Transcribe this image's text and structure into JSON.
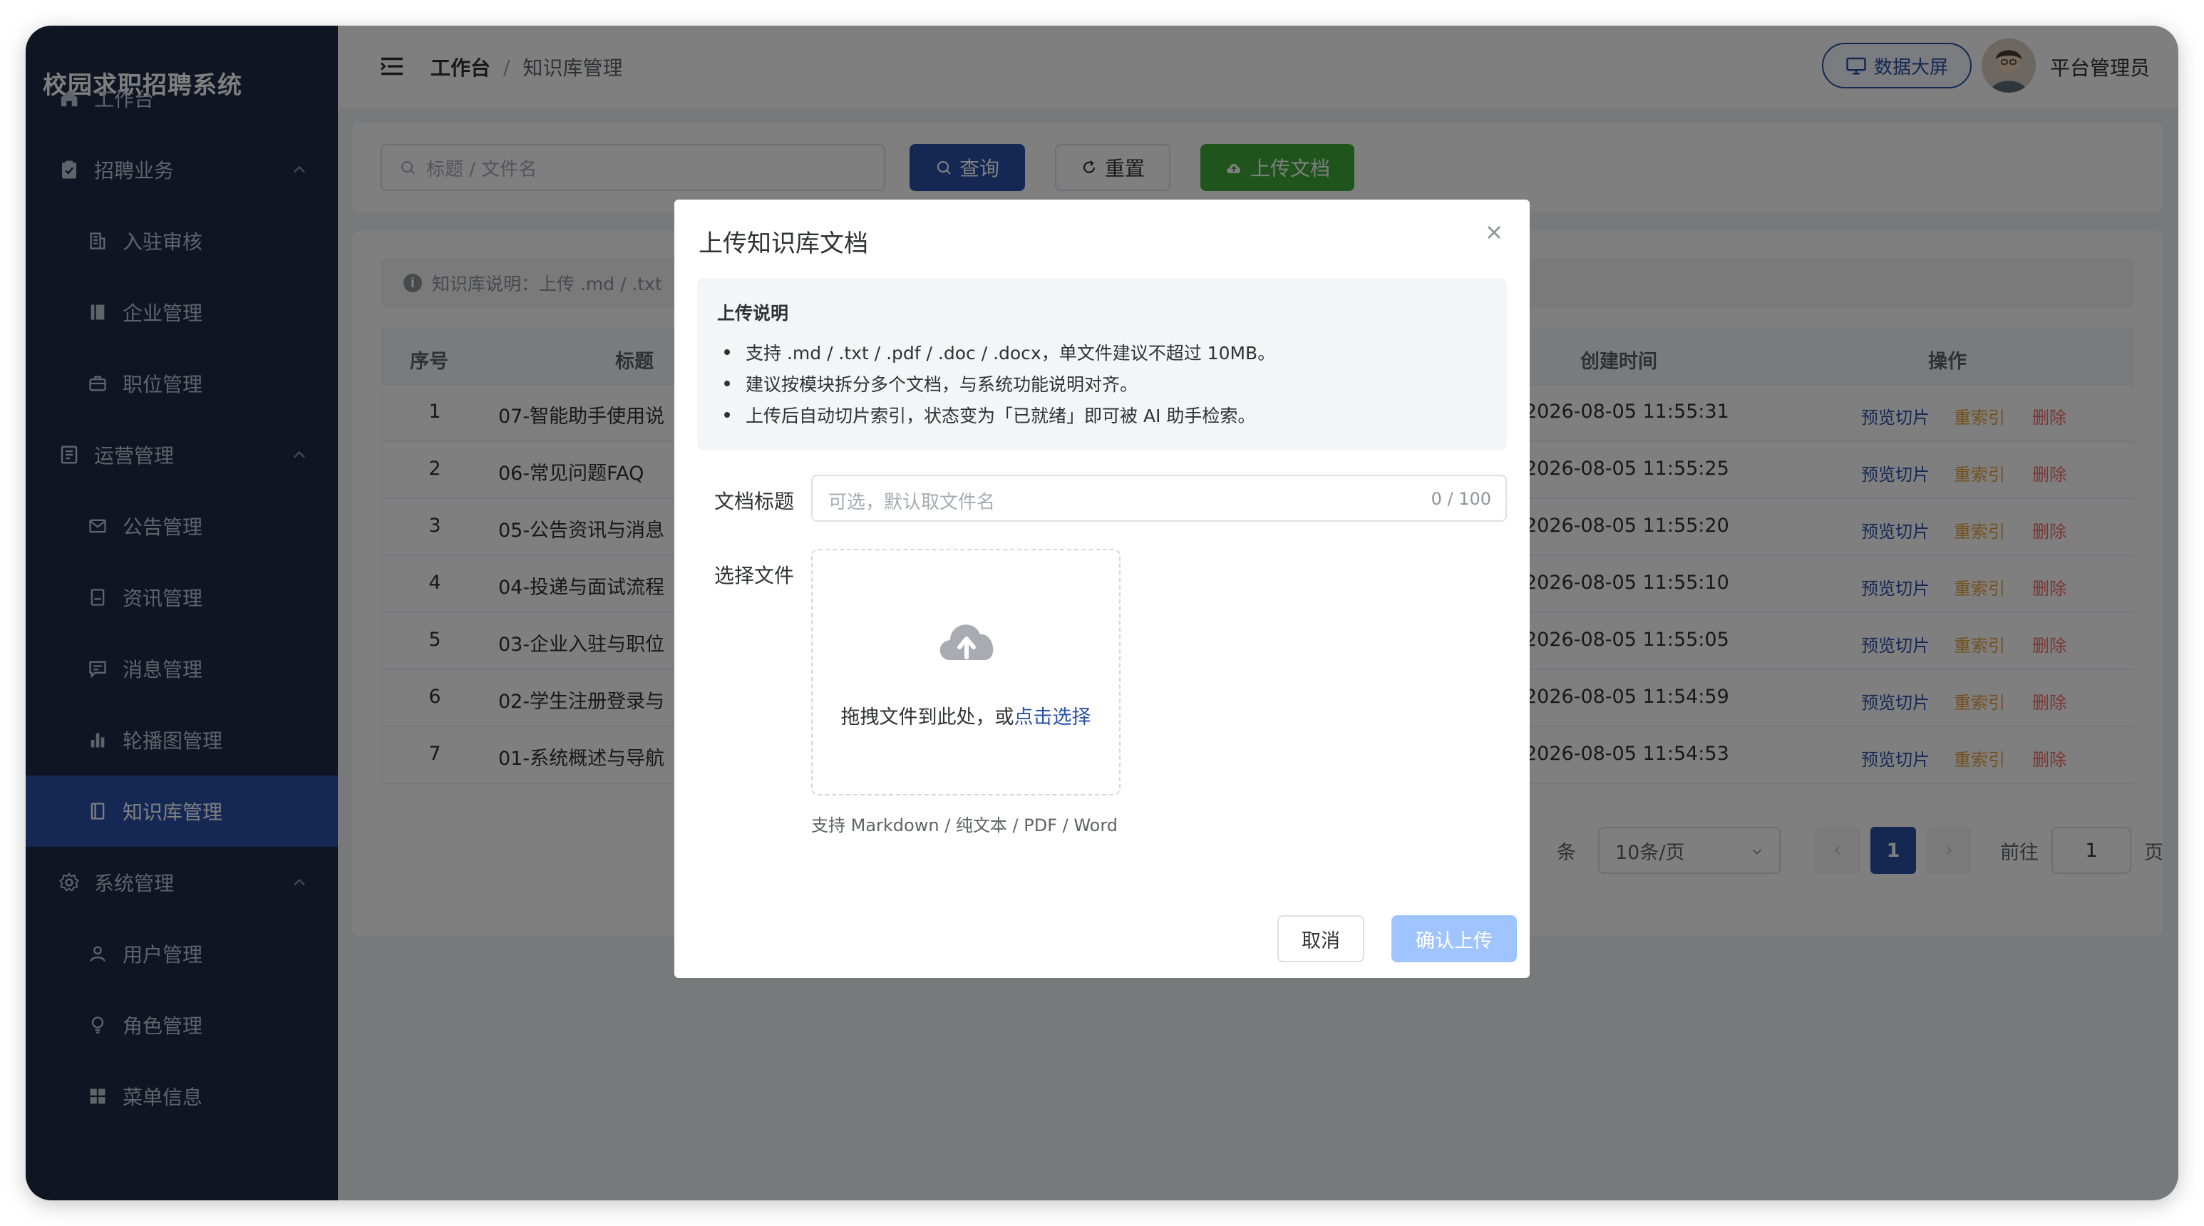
{
  "app": {
    "title": "校园求职招聘系统"
  },
  "sidebar": {
    "items": [
      {
        "label": "工作台",
        "icon": "home-icon"
      },
      {
        "label": "招聘业务",
        "icon": "clipboard-check-icon"
      },
      {
        "label": "入驻审核",
        "icon": "building-icon"
      },
      {
        "label": "企业管理",
        "icon": "book-icon"
      },
      {
        "label": "职位管理",
        "icon": "briefcase-icon"
      },
      {
        "label": "运营管理",
        "icon": "document-icon"
      },
      {
        "label": "公告管理",
        "icon": "mail-icon"
      },
      {
        "label": "资讯管理",
        "icon": "news-icon"
      },
      {
        "label": "消息管理",
        "icon": "message-icon"
      },
      {
        "label": "轮播图管理",
        "icon": "bar-chart-icon"
      },
      {
        "label": "知识库管理",
        "icon": "notebook-icon"
      },
      {
        "label": "系统管理",
        "icon": "gear-icon"
      },
      {
        "label": "用户管理",
        "icon": "user-icon"
      },
      {
        "label": "角色管理",
        "icon": "bulb-icon"
      },
      {
        "label": "菜单信息",
        "icon": "grid-icon"
      }
    ],
    "active": "知识库管理"
  },
  "header": {
    "breadcrumb": [
      "工作台",
      "知识库管理"
    ],
    "breadcrumb_sep": "/",
    "screen_button": "数据大屏",
    "user_name": "平台管理员"
  },
  "search": {
    "placeholder": "标题 / 文件名",
    "query_label": "查询",
    "reset_label": "重置",
    "upload_label": "上传文档"
  },
  "notice": {
    "text": "知识库说明：上传 .md / .txt"
  },
  "table": {
    "columns": [
      "序号",
      "标题",
      "创建时间",
      "操作"
    ],
    "rows": [
      {
        "index": "1",
        "title": "07-智能助手使用说",
        "created": "2026-08-05 11:55:31"
      },
      {
        "index": "2",
        "title": "06-常见问题FAQ",
        "created": "2026-08-05 11:55:25"
      },
      {
        "index": "3",
        "title": "05-公告资讯与消息",
        "created": "2026-08-05 11:55:20"
      },
      {
        "index": "4",
        "title": "04-投递与面试流程",
        "created": "2026-08-05 11:55:10"
      },
      {
        "index": "5",
        "title": "03-企业入驻与职位",
        "created": "2026-08-05 11:55:05"
      },
      {
        "index": "6",
        "title": "02-学生注册登录与",
        "created": "2026-08-05 11:54:59"
      },
      {
        "index": "7",
        "title": "01-系统概述与导航",
        "created": "2026-08-05 11:54:53"
      }
    ],
    "actions": {
      "preview": "预览切片",
      "reindex": "重索引",
      "delete": "删除"
    }
  },
  "pagination": {
    "total_suffix": "条",
    "page_size": "10条/页",
    "current_page": "1",
    "goto_prefix": "前往",
    "goto_value": "1",
    "goto_suffix": "页"
  },
  "dialog": {
    "title": "上传知识库文档",
    "info_title": "上传说明",
    "info_items": [
      "支持 .md / .txt / .pdf / .doc / .docx，单文件建议不超过 10MB。",
      "建议按模块拆分多个文档，与系统功能说明对齐。",
      "上传后自动切片索引，状态变为「已就绪」即可被 AI 助手检索。"
    ],
    "title_label": "文档标题",
    "title_placeholder": "可选，默认取文件名",
    "title_counter": "0 / 100",
    "file_label": "选择文件",
    "drop_text": "拖拽文件到此处，或",
    "drop_link": "点击选择",
    "drop_tip": "支持 Markdown / 纯文本 / PDF / Word",
    "cancel_label": "取消",
    "confirm_label": "确认上传"
  },
  "colors": {
    "sidebar_bg": "#1f2a44",
    "primary": "#2a50a8",
    "success": "#3fa83a",
    "warning": "#e6a23c",
    "danger": "#f56c6c",
    "confirm_disabled": "#a0c4ff"
  }
}
